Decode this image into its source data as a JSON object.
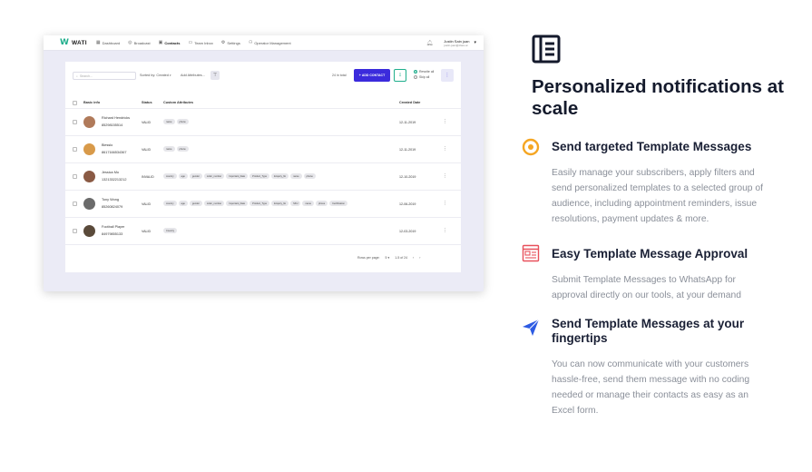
{
  "app": {
    "logo_text": "WATI",
    "nav": [
      {
        "label": "Dashboard",
        "icon": "dashboard-icon"
      },
      {
        "label": "Broadcast",
        "icon": "broadcast-icon"
      },
      {
        "label": "Contacts",
        "icon": "contacts-icon"
      },
      {
        "label": "Team Inbox",
        "icon": "inbox-icon"
      },
      {
        "label": "Settings",
        "icon": "gear-icon"
      },
      {
        "label": "Operator Management",
        "icon": "operators-icon"
      }
    ],
    "user": {
      "name": "Justin Sain juan",
      "email": "justin.juan@clare.ai"
    },
    "toolbar": {
      "search_placeholder": "Search...",
      "sort_label": "Sorted by:",
      "sort_value": "Created",
      "add_attributes": "Add Attributes...",
      "total": "24 in total",
      "add_contact": "ADD CONTACT",
      "radio_rewrite": "Rewrite all",
      "radio_skip": "Skip all"
    },
    "columns": {
      "basic_info": "Basic info",
      "status": "Status",
      "custom_attributes": "Custom Attributes",
      "created_date": "Created Date"
    },
    "contacts": [
      {
        "name": "Richard Hendricks",
        "phone": "85298155514",
        "status": "VALID",
        "tags": [
          "name",
          "phone"
        ],
        "date": "12-11-2019"
      },
      {
        "name": "Blesslo",
        "phone": "8617166534367",
        "status": "VALID",
        "tags": [
          "name",
          "phone"
        ],
        "date": "12-11-2019"
      },
      {
        "name": "Jessica Mo",
        "phone": "1321332213212",
        "status": "INVALID",
        "tags": [
          "country",
          "age",
          "gender",
          "order_number",
          "Important_Date",
          "Product_Type",
          "Enquiry_flo",
          "name",
          "phone"
        ],
        "date": "12-10-2019"
      },
      {
        "name": "Tony Wong",
        "phone": "85260824079",
        "status": "VALID",
        "tags": [
          "country",
          "age",
          "gender",
          "order_number",
          "Important_Date",
          "Product_Type",
          "Enquiry_flo",
          "SKU",
          "name",
          "phone",
          "Certification"
        ],
        "date": "12-06-2019"
      },
      {
        "name": "Football Player",
        "phone": "84979855133",
        "status": "VALID",
        "tags": [
          "Country"
        ],
        "date": "12-03-2019"
      }
    ],
    "pager": {
      "rows_label": "Rows per page:",
      "rows_value": "5",
      "range": "1-5 of 24",
      "prev": "‹",
      "next": "›"
    }
  },
  "marketing": {
    "title": "Personalized notifications at scale",
    "features": [
      {
        "title": "Send targeted Template Messages",
        "desc": "Easily manage your subscribers, apply filters and send personalized templates to a selected group of audience, including appointment reminders, issue resolutions, payment updates & more.",
        "icon": "target-icon"
      },
      {
        "title": "Easy Template Message Approval",
        "desc": "Submit Template Messages to WhatsApp for approval directly on our tools, at your demand",
        "icon": "template-icon"
      },
      {
        "title": "Send Template Messages at your fingertips",
        "desc": "You can now communicate with your customers hassle-free, send them message with no coding needed or manage their contacts as easy as an Excel form.",
        "icon": "paper-plane-icon"
      }
    ]
  },
  "colors": {
    "brand_green": "#1fae8c",
    "primary_blue": "#3b2bdc",
    "accent_orange": "#f5a623",
    "accent_red": "#e8505b",
    "accent_blue": "#2d5be3"
  }
}
